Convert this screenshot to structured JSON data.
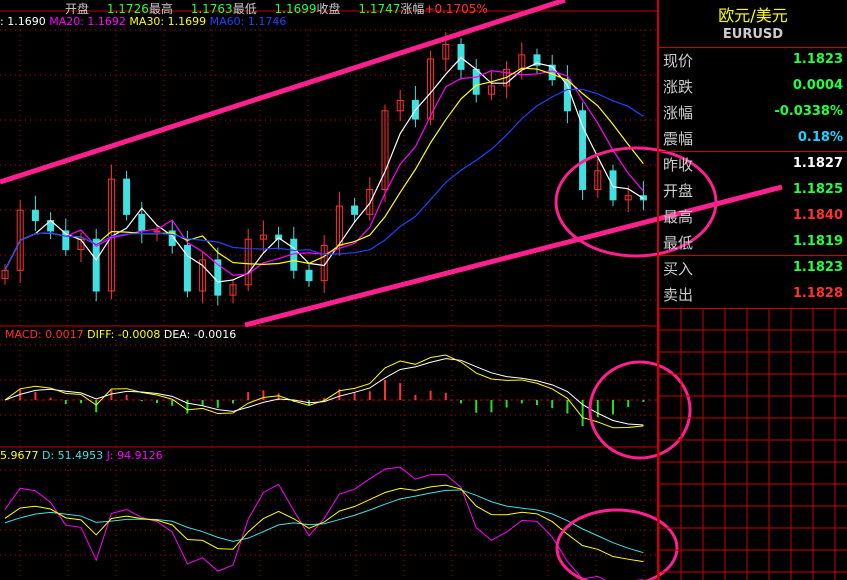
{
  "header": {
    "open_label": "开盘",
    "open": "1.1726",
    "high_label": "最高",
    "high": "1.1763",
    "low_label": "最低",
    "low": "1.1699",
    "close_label": "收盘",
    "close": "1.1747",
    "change_label": "涨幅",
    "change": "+0.1705%"
  },
  "ma_legend": {
    "ma10": ": 1.1690",
    "ma20_label": "MA20:",
    "ma20": "1.1692",
    "ma30_label": "MA30:",
    "ma30": "1.1699",
    "ma60_label": "MA60:",
    "ma60": "1.1746"
  },
  "macd_legend": {
    "macd": "MACD: 0.0017",
    "diff": "DIFF: -0.0008",
    "dea": "DEA: -0.0016"
  },
  "kdj_legend": {
    "k": "5.9677",
    "d": "D: 51.4953",
    "j": "J: 94.9126"
  },
  "colors": {
    "up": "#ff3030",
    "down": "#40e0e0",
    "grid": "#c00000",
    "annot": "#ff1f8f",
    "ma10": "#ffffff",
    "ma20": "#ff00ff",
    "ma30": "#ffff00",
    "ma60": "#2040ff"
  },
  "quote": {
    "title": "欧元/美元",
    "symbol": "EURUSD",
    "rows": [
      {
        "label": "现价",
        "value": "1.1823",
        "color": "#20ff40"
      },
      {
        "label": "涨跌",
        "value": "0.0004",
        "color": "#20ff40"
      },
      {
        "label": "涨幅",
        "value": "-0.0338%",
        "color": "#20ff40"
      },
      {
        "label": "震幅",
        "value": "0.18%",
        "color": "#20d0ff"
      },
      {
        "label": "昨收",
        "value": "1.1827",
        "color": "#ffffff"
      },
      {
        "label": "开盘",
        "value": "1.1825",
        "color": "#20ff40"
      },
      {
        "label": "最高",
        "value": "1.1840",
        "color": "#ff3030"
      },
      {
        "label": "最低",
        "value": "1.1819",
        "color": "#20ff40"
      },
      {
        "label": "买入",
        "value": "1.1823",
        "color": "#20ff40"
      },
      {
        "label": "卖出",
        "value": "1.1828",
        "color": "#ff3030"
      }
    ]
  },
  "chart_data": {
    "type": "candlestick",
    "symbol": "EURUSD",
    "ylim": [
      1.164,
      1.178
    ],
    "closes": [
      1.1664,
      1.1693,
      1.1688,
      1.1683,
      1.1674,
      1.1679,
      1.1654,
      1.1708,
      1.1691,
      1.1683,
      1.1683,
      1.1676,
      1.1654,
      1.1669,
      1.1652,
      1.1657,
      1.1679,
      1.1681,
      1.1679,
      1.1664,
      1.1659,
      1.1676,
      1.1695,
      1.1691,
      1.1703,
      1.1741,
      1.1746,
      1.1737,
      1.1766,
      1.1773,
      1.1761,
      1.1749,
      1.1753,
      1.1761,
      1.1768,
      1.1763,
      1.1756,
      1.1741,
      1.1703,
      1.1712,
      1.1698,
      1.17,
      1.1698
    ],
    "indicators": [
      "MA10",
      "MA20",
      "MA30",
      "MA60",
      "MACD",
      "KDJ"
    ]
  }
}
